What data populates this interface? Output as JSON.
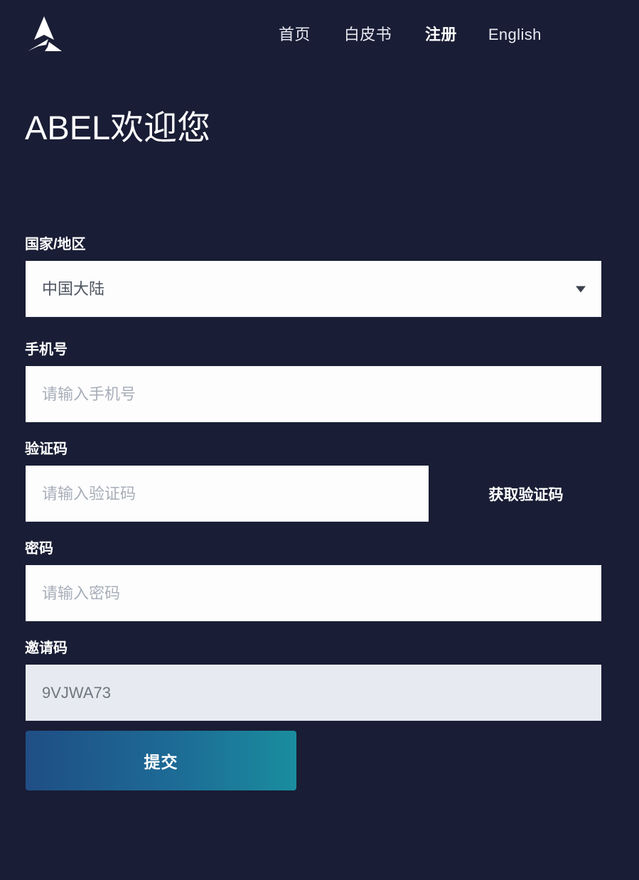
{
  "brand": {
    "logo_icon": "abel-triangle-logo"
  },
  "nav": {
    "items": [
      {
        "label": "首页",
        "active": false
      },
      {
        "label": "白皮书",
        "active": false
      },
      {
        "label": "注册",
        "active": true
      },
      {
        "label": "English",
        "active": false
      }
    ]
  },
  "page": {
    "title": "ABEL欢迎您"
  },
  "form": {
    "country": {
      "label": "国家/地区",
      "value": "中国大陆",
      "caret_icon": "chevron-down-icon"
    },
    "phone": {
      "label": "手机号",
      "placeholder": "请输入手机号",
      "value": ""
    },
    "verification": {
      "label": "验证码",
      "placeholder": "请输入验证码",
      "value": "",
      "get_code_label": "获取验证码"
    },
    "password": {
      "label": "密码",
      "placeholder": "请输入密码",
      "value": ""
    },
    "invite": {
      "label": "邀请码",
      "value": "9VJWA73"
    },
    "submit_label": "提交"
  },
  "colors": {
    "background": "#191d35",
    "field_background": "#fdfdfe",
    "field_readonly_background": "#e7eaf0",
    "text_primary": "#ffffff",
    "placeholder": "#a8aeb8",
    "submit_gradient_start": "#1f4e85",
    "submit_gradient_end": "#1a8d9e"
  }
}
